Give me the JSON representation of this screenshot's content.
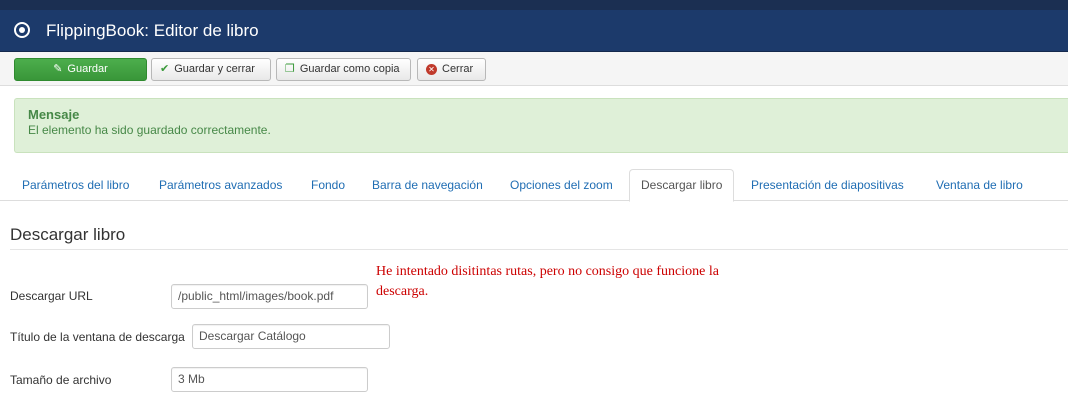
{
  "window": {
    "title": "FlippingBook: Editor de libro",
    "icon": "target-icon"
  },
  "toolbar": {
    "save_label": "Guardar",
    "save_close_label": "Guardar y cerrar",
    "save_copy_label": "Guardar como copia",
    "close_label": "Cerrar"
  },
  "alert": {
    "heading": "Mensaje",
    "message": "El elemento ha sido guardado correctamente."
  },
  "tabs": [
    {
      "label": "Parámetros del libro",
      "active": false
    },
    {
      "label": "Parámetros avanzados",
      "active": false
    },
    {
      "label": "Fondo",
      "active": false
    },
    {
      "label": "Barra de navegación",
      "active": false
    },
    {
      "label": "Opciones del zoom",
      "active": false
    },
    {
      "label": "Descargar libro",
      "active": true
    },
    {
      "label": "Presentación de diapositivas",
      "active": false
    },
    {
      "label": "Ventana de libro",
      "active": false
    }
  ],
  "section": {
    "title": "Descargar libro"
  },
  "fields": {
    "download_url": {
      "label": "Descargar URL",
      "value": "/public_html/images/book.pdf"
    },
    "window_title": {
      "label": "Título de la ventana de descarga",
      "value": "Descargar Catálogo"
    },
    "file_size": {
      "label": "Tamaño de archivo",
      "value": "3 Mb"
    }
  },
  "annotation": {
    "text": "He intentado disitintas rutas, pero no consigo que funcione la descarga."
  },
  "colors": {
    "titlebar": "#1c3a6b",
    "save_button": "#4cae4c",
    "alert_background": "#dff0d8",
    "alert_text": "#468847",
    "tab_link": "#1f6db3",
    "annotation_text": "#cc0000"
  }
}
